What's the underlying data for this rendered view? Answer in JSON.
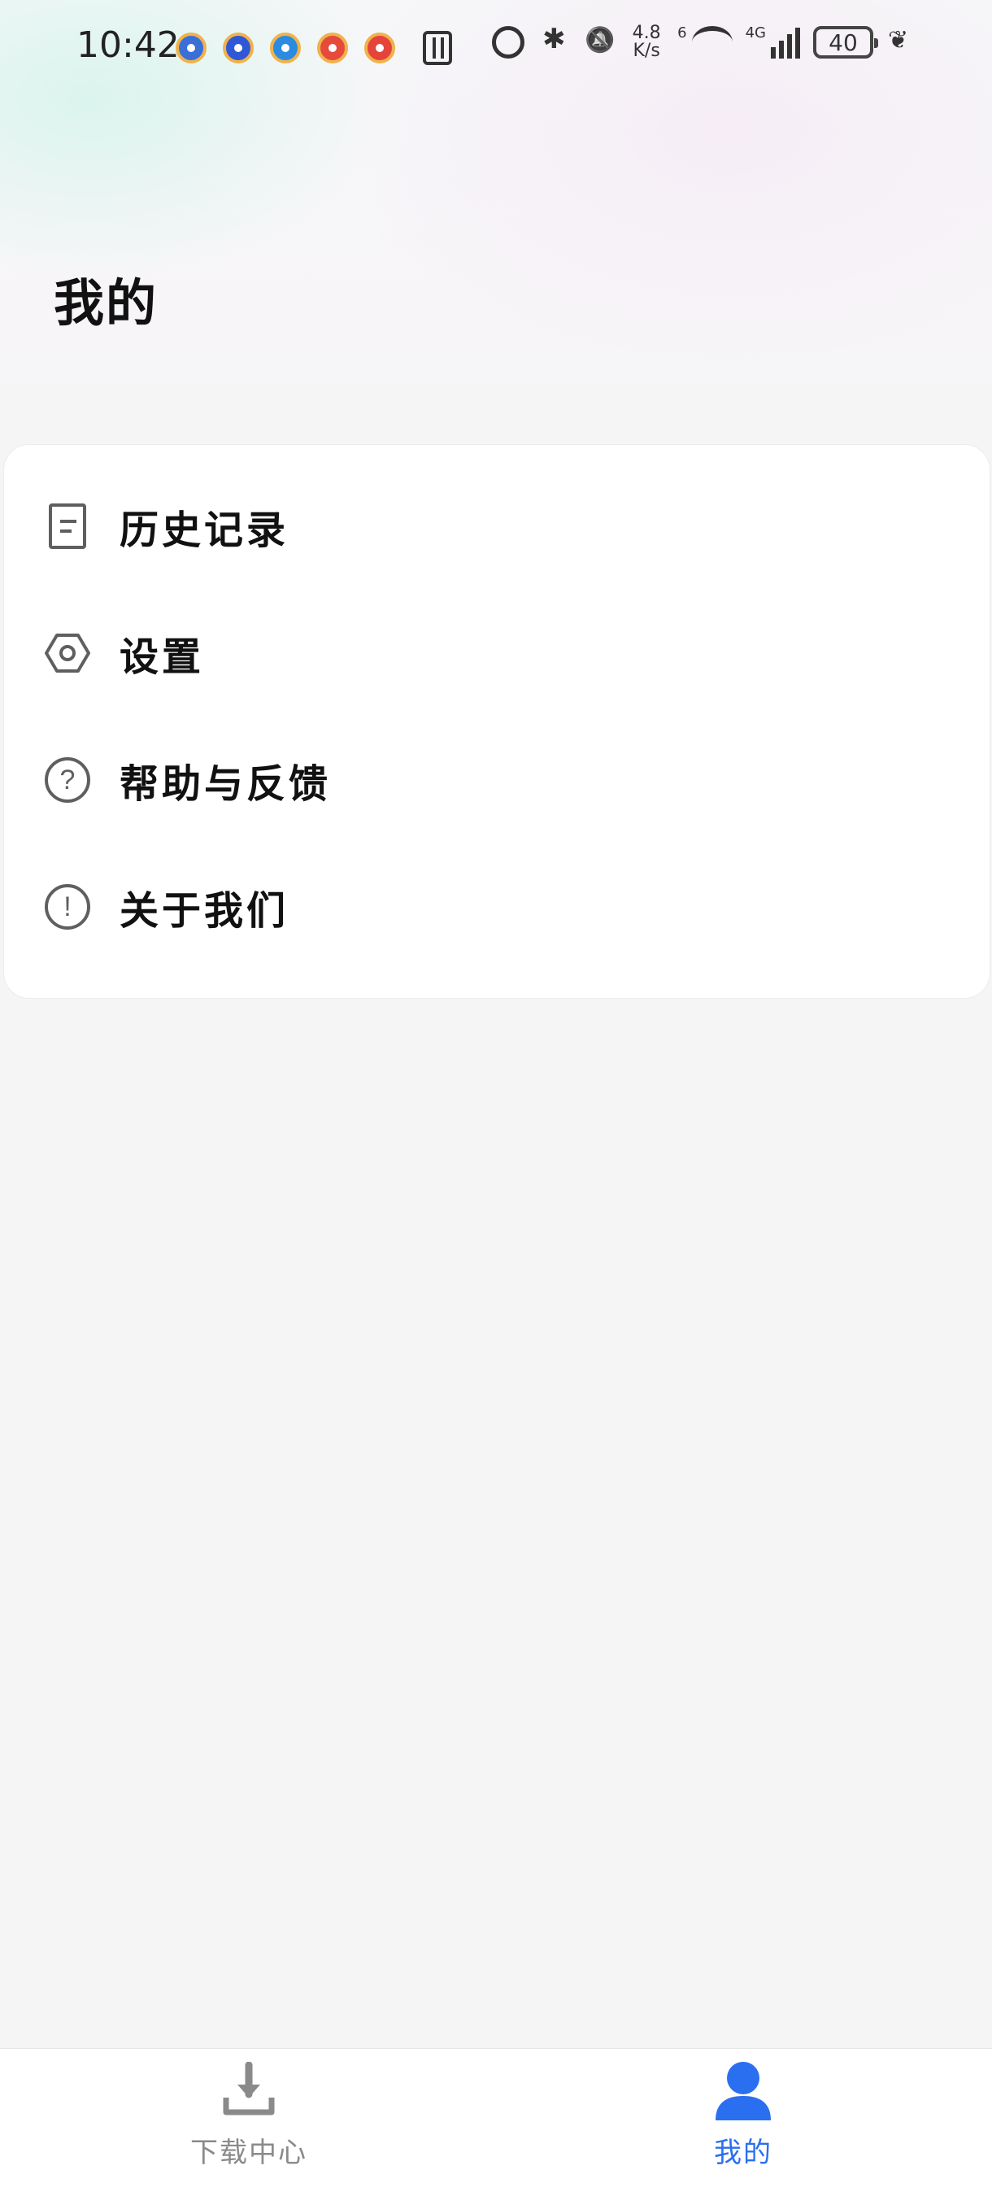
{
  "status_bar": {
    "time": "10:42",
    "network_speed_value": "4.8",
    "network_speed_unit": "K/s",
    "wifi_label": "6",
    "cell_label": "4G",
    "battery": "40"
  },
  "page": {
    "title": "我的"
  },
  "menu": {
    "items": [
      {
        "label": "历史记录",
        "icon": "document-icon"
      },
      {
        "label": "设置",
        "icon": "settings-hexagon-icon"
      },
      {
        "label": "帮助与反馈",
        "icon": "help-circle-icon",
        "glyph": "?"
      },
      {
        "label": "关于我们",
        "icon": "info-circle-icon",
        "glyph": "!"
      }
    ]
  },
  "bottom_nav": {
    "tabs": [
      {
        "label": "下载中心",
        "icon": "download-icon",
        "active": false
      },
      {
        "label": "我的",
        "icon": "user-icon",
        "active": true
      }
    ]
  },
  "colors": {
    "accent": "#2A6FF0",
    "inactive": "#8A8A8A",
    "icon_gray": "#5F5F5F",
    "page_background": "#F5F5F5"
  }
}
